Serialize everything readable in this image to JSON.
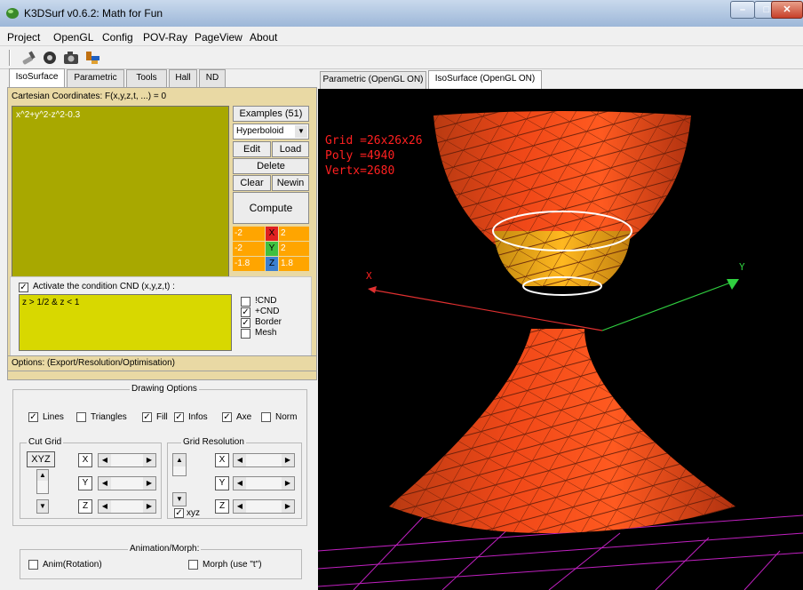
{
  "window": {
    "title": "K3DSurf v0.6.2: Math for Fun"
  },
  "menu": [
    "Project",
    "OpenGL",
    "Config",
    "POV-Ray",
    "PageView",
    "About"
  ],
  "toolbar": [
    "brush-icon",
    "gear-icon",
    "camera-icon",
    "paint-icon"
  ],
  "left_tabs": [
    "IsoSurface",
    "Parametric",
    "Tools",
    "Hall",
    "ND"
  ],
  "iso": {
    "coords_label": "Cartesian Coordinates: F(x,y,z,t, ...) = 0",
    "equation": "x^2+y^2-z^2-0.3",
    "examples_label": "Examples (51)",
    "example_selected": "Hyperboloid",
    "buttons": {
      "edit": "Edit",
      "load": "Load",
      "delete": "Delete",
      "clear": "Clear",
      "newin": "Newin",
      "compute": "Compute"
    },
    "ranges": [
      {
        "axis": "X",
        "min": "-2",
        "max": "2",
        "color": "#e02020"
      },
      {
        "axis": "Y",
        "min": "-2",
        "max": "2",
        "color": "#40c040"
      },
      {
        "axis": "Z",
        "min": "-1.8",
        "max": "1.8",
        "color": "#3b7fd0"
      }
    ]
  },
  "condition": {
    "label": "Activate the condition CND (x,y,z,t) :",
    "checked": true,
    "text": "z > 1/2 & z < 1",
    "options": [
      {
        "label": "!CND",
        "checked": false
      },
      {
        "label": "+CND",
        "checked": true
      },
      {
        "label": "Border",
        "checked": true
      },
      {
        "label": "Mesh",
        "checked": false
      }
    ]
  },
  "options_bar": "Options: (Export/Resolution/Optimisation)",
  "drawing": {
    "title": "Drawing Options",
    "checks": [
      {
        "label": "Lines",
        "checked": true
      },
      {
        "label": "Triangles",
        "checked": false
      },
      {
        "label": "Fill",
        "checked": true
      },
      {
        "label": "Infos",
        "checked": true
      },
      {
        "label": "Axe",
        "checked": true
      },
      {
        "label": "Norm",
        "checked": false
      }
    ],
    "cut_grid": "Cut Grid",
    "grid_resolution": "Grid Resolution",
    "xyz_button": "XYZ",
    "axes": [
      "X",
      "Y",
      "Z"
    ],
    "xyz_check": "xyz"
  },
  "animation": {
    "title": "Animation/Morph:",
    "anim": "Anim(Rotation)",
    "morph": "Morph (use \"t\")"
  },
  "right_tabs": [
    "Parametric (OpenGL ON)",
    "IsoSurface (OpenGL ON)"
  ],
  "gl": {
    "info": [
      "Grid =26x26x26",
      "Poly =4940",
      "Vertx=2680"
    ],
    "axis_x": "X",
    "axis_y": "Y"
  }
}
